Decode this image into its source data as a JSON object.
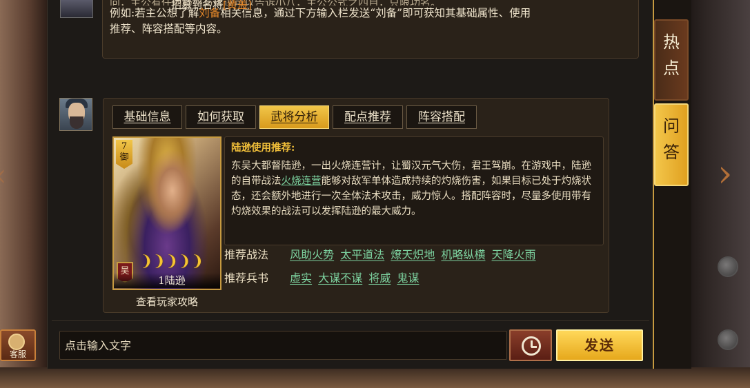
{
  "prev_message": {
    "top_tags_prefix": "",
    "top_tags_main": "招募到名将",
    "top_tags_hero": "黄盖",
    "cut_line": "问，主公有任何疑惑与建议可以告诉小八，主公公式之四目，只限功名。",
    "line1_a": "例如:若主公想了解",
    "line1_hl": "刘备",
    "line1_b": "相关信息，通过下方输入栏发送“刘备”即可获知其基础属性、使用",
    "line2": "推荐、阵容搭配等内容。"
  },
  "tabs": [
    {
      "label": "基础信息",
      "active": false
    },
    {
      "label": "如何获取",
      "active": false
    },
    {
      "label": "武将分析",
      "active": true
    },
    {
      "label": "配点推荐",
      "active": false
    },
    {
      "label": "阵容搭配",
      "active": false
    }
  ],
  "hero_card": {
    "level": "7",
    "type": "御",
    "faction": "吴",
    "stars": "❩❩❩❩❩",
    "name": "1陆逊",
    "guide_link": "查看玩家攻略"
  },
  "analysis": {
    "title": "陆逊使用推荐:",
    "body_a": "东吴大都督陆逊，一出火烧连营计，让蜀汉元气大伤，君王驾崩。在游戏中，陆逊的自带战法",
    "body_link": "火烧连营",
    "body_b": "能够对敌军单体造成持续的灼烧伤害，如果目标已处于灼烧状态，还会额外地进行一次全体法术攻击，威力惊人。搭配阵容时，尽量多使用带有灼烧效果的战法可以发挥陆逊的最大威力。"
  },
  "recommend_tactics": {
    "label": "推荐战法",
    "items": [
      "风助火势",
      "太平道法",
      "燎天炽地",
      "机略纵横",
      "天降火雨"
    ]
  },
  "recommend_books": {
    "label": "推荐兵书",
    "items": [
      "虚实",
      "大谋不谋",
      "将威",
      "鬼谋"
    ]
  },
  "side_tabs": {
    "hot": "热\n点",
    "qa": "问\n答"
  },
  "input": {
    "placeholder": "点击输入文字",
    "value": ""
  },
  "buttons": {
    "send": "发送",
    "service": "客服"
  },
  "colors": {
    "accent_gold": "#f1c649",
    "link_green": "#7dd3a0",
    "highlight_orange": "#e88a2a"
  }
}
